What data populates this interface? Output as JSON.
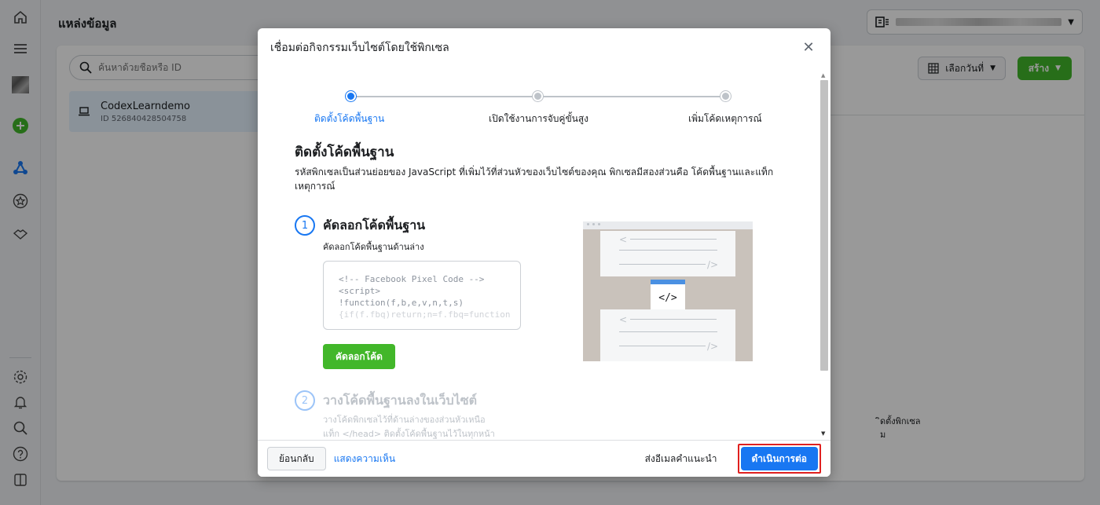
{
  "header": {
    "title": "แหล่งข้อมูล"
  },
  "search": {
    "placeholder": "ค้นหาด้วยชื่อหรือ ID"
  },
  "pixel": {
    "name": "CodexLearndemo",
    "id": "ID 526840428504758"
  },
  "toolbar": {
    "date_label": "เลือกวันที่",
    "create_label": "สร้าง"
  },
  "background": {
    "line1": "ิดตั้งพิกเซล",
    "line2": "ม"
  },
  "modal": {
    "title": "เชื่อมต่อกิจกรรมเว็บไซต์โดยใช้พิกเซล",
    "steps": [
      {
        "label": "ติดตั้งโค้ดพื้นฐาน"
      },
      {
        "label": "เปิดใช้งานการจับคู่ขั้นสูง"
      },
      {
        "label": "เพิ่มโค้ดเหตุการณ์"
      }
    ],
    "section_title": "ติดตั้งโค้ดพื้นฐาน",
    "section_desc": "รหัสพิกเซลเป็นส่วนย่อยของ JavaScript ที่เพิ่มไว้ที่ส่วนหัวของเว็บไซต์ของคุณ พิกเซลมีสองส่วนคือ โค้ดพื้นฐานและแท็กเหตุการณ์",
    "step1": {
      "num": "1",
      "title": "คัดลอกโค้ดพื้นฐาน",
      "subtitle": "คัดลอกโค้ดพื้นฐานด้านล่าง",
      "code_lines": [
        "<!-- Facebook Pixel Code -->",
        "<script>",
        "!function(f,b,e,v,n,t,s)",
        "{if(f.fbq)return;n=f.fbq=function"
      ],
      "copy_label": "คัดลอกโค้ด"
    },
    "illustration_code": "</>",
    "step2": {
      "num": "2",
      "title": "วางโค้ดพื้นฐานลงในเว็บไซต์",
      "line1": "วางโค้ดพิกเซลไว้ที่ด้านล่างของส่วนหัวเหนือ",
      "line2": "แท็ก </head> ติดตั้งโค้ดพื้นฐานไว้ในทุกหน้า"
    },
    "footer": {
      "back_label": "ย้อนกลับ",
      "feedback_label": "แสดงความเห็น",
      "email_label": "ส่งอีเมลคำแนะนำ",
      "continue_label": "ดำเนินการต่อ"
    }
  },
  "colors": {
    "primary": "#1877f2",
    "green": "#42b72a",
    "highlight": "#e0201f"
  }
}
